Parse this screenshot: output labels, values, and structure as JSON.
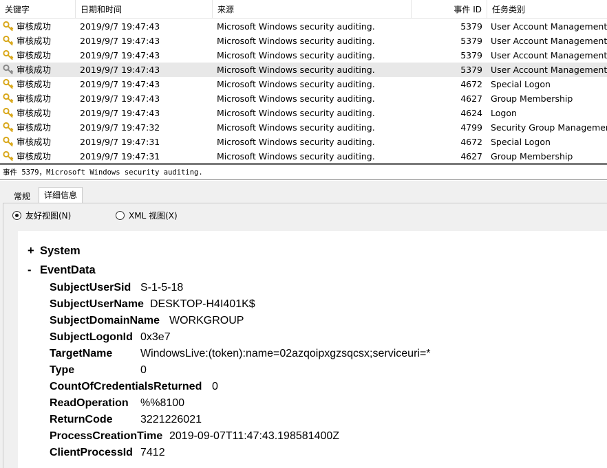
{
  "grid": {
    "columns": {
      "keyword": "关键字",
      "datetime": "日期和时间",
      "source": "来源",
      "event_id": "事件 ID",
      "task_category": "任务类别"
    },
    "rows": [
      {
        "keyword": "审核成功",
        "datetime": "2019/9/7 19:47:43",
        "source": "Microsoft Windows security auditing.",
        "event_id": "5379",
        "task_category": "User Account Management"
      },
      {
        "keyword": "审核成功",
        "datetime": "2019/9/7 19:47:43",
        "source": "Microsoft Windows security auditing.",
        "event_id": "5379",
        "task_category": "User Account Management"
      },
      {
        "keyword": "审核成功",
        "datetime": "2019/9/7 19:47:43",
        "source": "Microsoft Windows security auditing.",
        "event_id": "5379",
        "task_category": "User Account Management"
      },
      {
        "keyword": "审核成功",
        "datetime": "2019/9/7 19:47:43",
        "source": "Microsoft Windows security auditing.",
        "event_id": "5379",
        "task_category": "User Account Management"
      },
      {
        "keyword": "审核成功",
        "datetime": "2019/9/7 19:47:43",
        "source": "Microsoft Windows security auditing.",
        "event_id": "4672",
        "task_category": "Special Logon"
      },
      {
        "keyword": "审核成功",
        "datetime": "2019/9/7 19:47:43",
        "source": "Microsoft Windows security auditing.",
        "event_id": "4627",
        "task_category": "Group Membership"
      },
      {
        "keyword": "审核成功",
        "datetime": "2019/9/7 19:47:43",
        "source": "Microsoft Windows security auditing.",
        "event_id": "4624",
        "task_category": "Logon"
      },
      {
        "keyword": "审核成功",
        "datetime": "2019/9/7 19:47:32",
        "source": "Microsoft Windows security auditing.",
        "event_id": "4799",
        "task_category": "Security Group Management"
      },
      {
        "keyword": "审核成功",
        "datetime": "2019/9/7 19:47:31",
        "source": "Microsoft Windows security auditing.",
        "event_id": "4672",
        "task_category": "Special Logon"
      },
      {
        "keyword": "审核成功",
        "datetime": "2019/9/7 19:47:31",
        "source": "Microsoft Windows security auditing.",
        "event_id": "4627",
        "task_category": "Group Membership"
      }
    ],
    "selected_row_index": 3,
    "row_icon": "key-icon"
  },
  "event_caption": "事件 5379，Microsoft Windows security auditing.",
  "tabs": {
    "general": "常规",
    "details": "详细信息",
    "active": "details"
  },
  "view_mode": {
    "friendly": "友好视图(N)",
    "xml": "XML 视图(X)",
    "selected": "friendly"
  },
  "details": {
    "system": {
      "toggle": "+",
      "label": "System"
    },
    "event_data": {
      "toggle": "-",
      "label": "EventData"
    },
    "fields": [
      {
        "key": "SubjectUserSid",
        "value": "S-1-5-18"
      },
      {
        "key": "SubjectUserName",
        "value": "DESKTOP-H4I401K$"
      },
      {
        "key": "SubjectDomainName",
        "value": "WORKGROUP"
      },
      {
        "key": "SubjectLogonId",
        "value": "0x3e7"
      },
      {
        "key": "TargetName",
        "value": "WindowsLive:(token):name=02azqoipxgzsqcsx;serviceuri=*"
      },
      {
        "key": "Type",
        "value": "0"
      },
      {
        "key": "CountOfCredentialsReturned",
        "value": "0"
      },
      {
        "key": "ReadOperation",
        "value": "%%8100"
      },
      {
        "key": "ReturnCode",
        "value": "3221226021"
      },
      {
        "key": "ProcessCreationTime",
        "value": "2019-09-07T11:47:43.198581400Z"
      },
      {
        "key": "ClientProcessId",
        "value": "7412"
      }
    ]
  },
  "colors": {
    "selected_row": "#e8e8e8",
    "key_icon_gold": "#d9a81c",
    "key_icon_selected": "#8a8a8a",
    "pane_background": "#f0f0f0"
  }
}
